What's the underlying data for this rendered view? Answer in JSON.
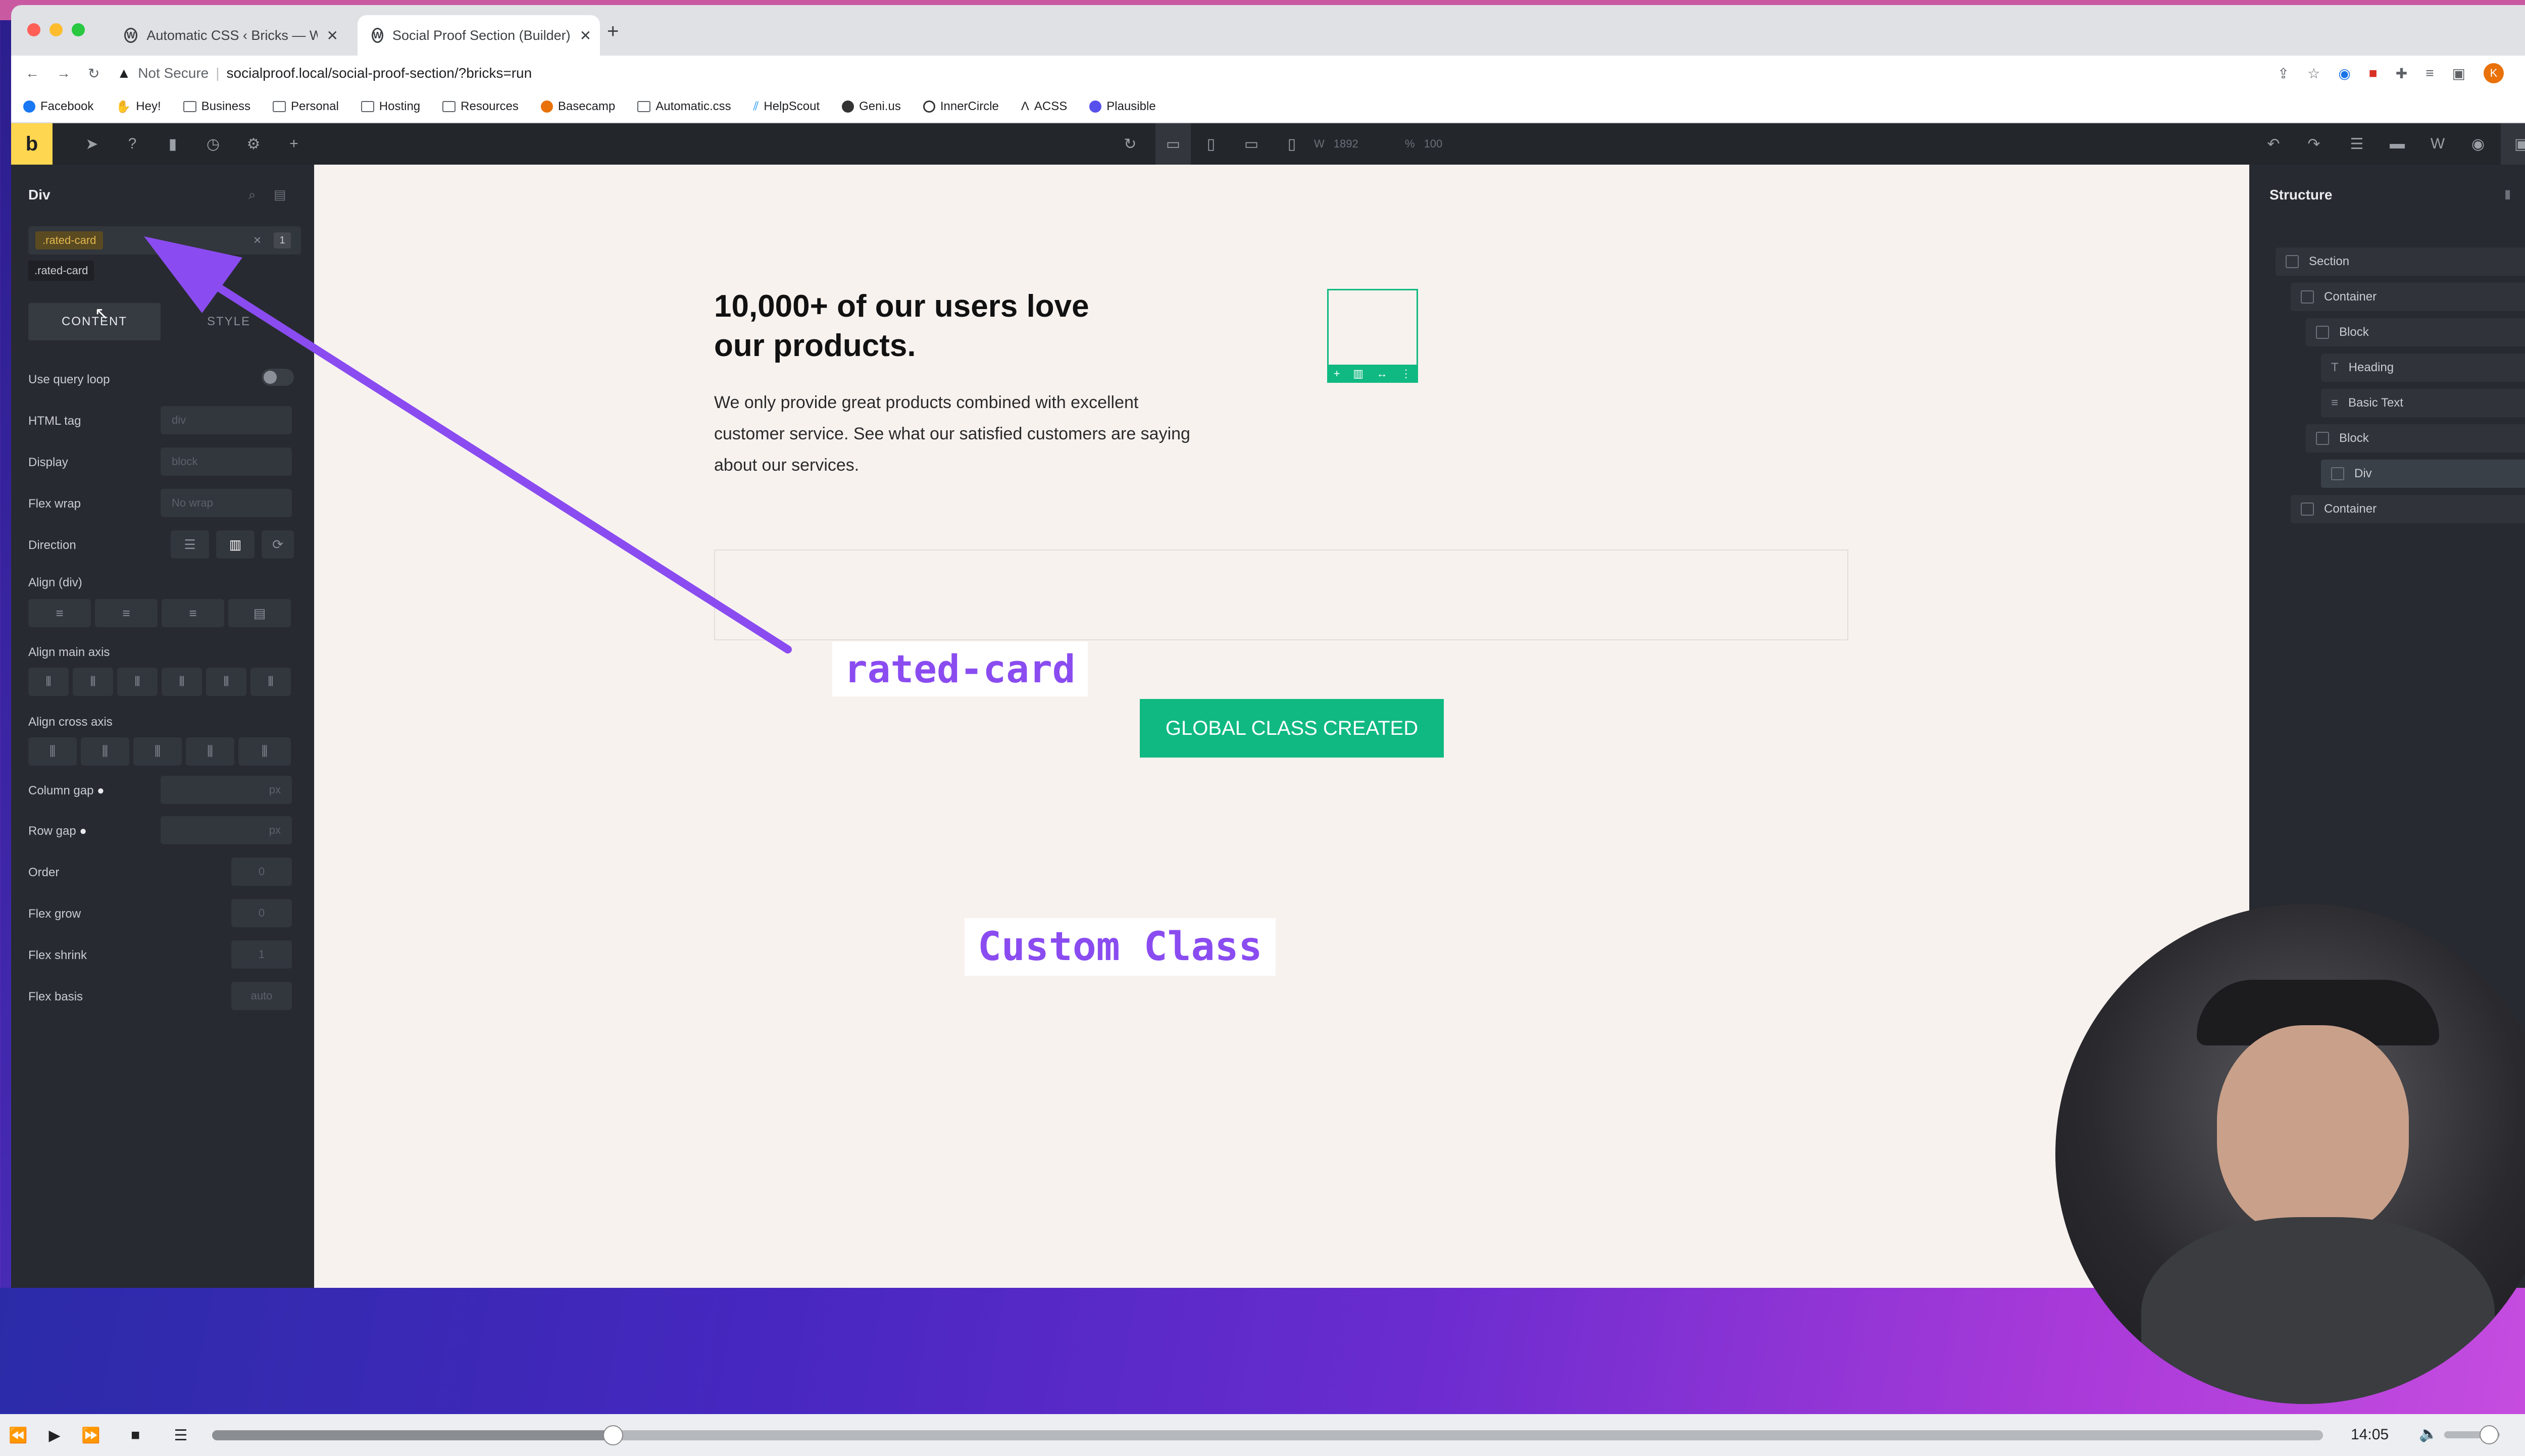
{
  "browser": {
    "tabs": [
      {
        "label": "Automatic CSS ‹ Bricks — Wor…",
        "active": false
      },
      {
        "label": "Social Proof Section (Builder)",
        "active": true
      }
    ],
    "new_tab_label": "+",
    "address": {
      "security": "Not Secure",
      "url": "socialproof.local/social-proof-section/?bricks=run"
    },
    "bookmarks": [
      "Facebook",
      "Hey!",
      "Business",
      "Personal",
      "Hosting",
      "Resources",
      "Basecamp",
      "Automatic.css",
      "HelpScout",
      "Geni.us",
      "InnerCircle",
      "ACSS",
      "Plausible"
    ],
    "profile_initial": "K"
  },
  "builder": {
    "logo": "b",
    "width_label": "W",
    "width_value": "1892",
    "zoom_label": "%",
    "zoom_value": "100"
  },
  "left_panel": {
    "title": "Div",
    "class_tag": ".rated-card",
    "class_count": "1",
    "class_clear": "×",
    "class_suggestion": ".rated-card",
    "tabs": [
      "CONTENT",
      "STYLE"
    ],
    "rows": {
      "query_loop": "Use query loop",
      "html_tag": "HTML tag",
      "html_tag_value": "div",
      "display": "Display",
      "display_value": "block",
      "flex_wrap": "Flex wrap",
      "flex_wrap_value": "No wrap",
      "direction": "Direction",
      "align_div": "Align (div)",
      "align_main": "Align main axis",
      "align_cross": "Align cross axis",
      "column_gap": "Column gap",
      "row_gap": "Row gap",
      "px": "px",
      "order": "Order",
      "order_value": "0",
      "flex_grow": "Flex grow",
      "flex_grow_value": "0",
      "flex_shrink": "Flex shrink",
      "flex_shrink_value": "1",
      "flex_basis": "Flex basis",
      "flex_basis_value": "auto"
    }
  },
  "canvas": {
    "heading_line1": "10,000+ of our users love",
    "heading_line2": "our products.",
    "body_line1": "We only provide great products combined with excellent",
    "body_line2": "customer service. See what our satisfied customers are saying",
    "body_line3": "about our services.",
    "overlay_label": "rated-card",
    "notification": "GLOBAL CLASS CREATED",
    "custom_class_label": "Custom Class"
  },
  "structure": {
    "title": "Structure",
    "items": [
      {
        "label": "Section",
        "level": 0
      },
      {
        "label": "Container",
        "level": 1
      },
      {
        "label": "Block",
        "level": 2
      },
      {
        "label": "Heading",
        "level": 3
      },
      {
        "label": "Basic Text",
        "level": 3
      },
      {
        "label": "Block",
        "level": 2
      },
      {
        "label": "Div",
        "level": 3,
        "selected": true
      },
      {
        "label": "Container",
        "level": 1
      }
    ]
  },
  "player": {
    "time": "14:05",
    "progress": 0.19
  },
  "colors": {
    "accent_green": "#10b981",
    "arrow_purple": "#8a4cf0",
    "class_tag_bg": "#5a4a22",
    "class_tag_text": "#e2b74a"
  }
}
